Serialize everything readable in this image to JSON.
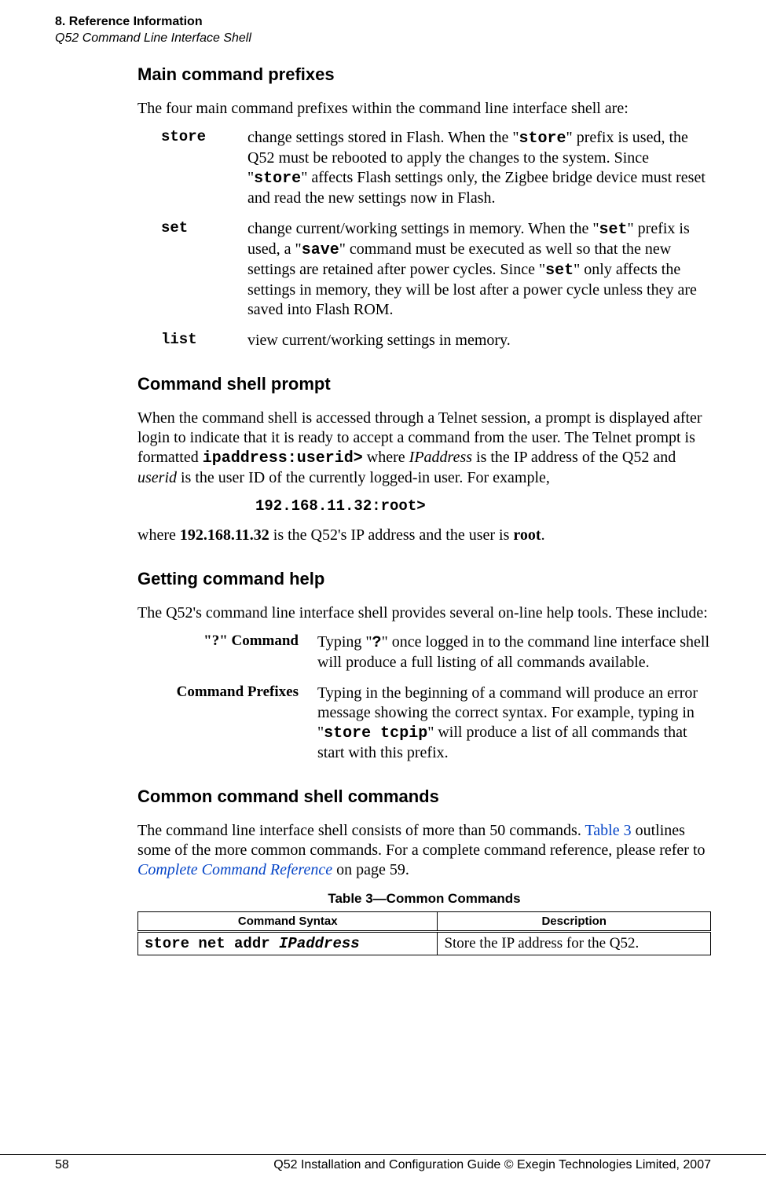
{
  "header": {
    "chapter": "8. Reference Information",
    "subtitle": "Q52 Command Line Interface Shell"
  },
  "sections": {
    "prefixes": {
      "heading": "Main command prefixes",
      "intro": "The four main command prefixes within the command line interface shell are:",
      "items": [
        {
          "term": "store",
          "desc_pre": "change settings stored in Flash. When the \"",
          "kw1": "store",
          "desc_mid": "\" prefix is used, the Q52 must be rebooted to apply the changes to the system. Since \"",
          "kw2": "store",
          "desc_post": "\" affects Flash settings only, the Zigbee bridge device must reset and read the new settings now in Flash."
        },
        {
          "term": "set",
          "desc_pre": "change current/working settings in memory. When the \"",
          "kw1": "set",
          "desc_mid1": "\" prefix is used, a \"",
          "kw2": "save",
          "desc_mid2": "\" command must be executed as well so that the new settings are retained after power cycles. Since \"",
          "kw3": "set",
          "desc_post": "\" only affects the settings in memory, they will be lost after a power cycle unless they are saved into Flash ROM."
        },
        {
          "term": "list",
          "desc": "view current/working settings in memory."
        }
      ]
    },
    "prompt": {
      "heading": "Command shell prompt",
      "p1_pre": "When the command shell is accessed through a Telnet session, a prompt is displayed after login to indicate that it is ready to accept a command from the user. The Telnet prompt is formatted ",
      "p1_code": "ipaddress:userid>",
      "p1_mid": " where ",
      "p1_it1": "IPaddress",
      "p1_mid2": " is the IP address of the Q52 and ",
      "p1_it2": "userid",
      "p1_post": " is the user ID of the currently logged-in user. For example,",
      "example": "192.168.11.32:root>",
      "p2_pre": "where ",
      "p2_b1": "192.168.11.32",
      "p2_mid": " is the Q52's IP address and the user is ",
      "p2_b2": "root",
      "p2_post": "."
    },
    "help": {
      "heading": "Getting command help",
      "intro": "The Q52's command line interface shell provides several on-line help tools. These include:",
      "items": [
        {
          "term": "\"?\" Command",
          "pre": "Typing \"",
          "kw": "?",
          "post": "\" once logged in to the command line interface shell will produce a full listing of all commands available."
        },
        {
          "term": "Command Prefixes",
          "pre": "Typing in the beginning of a command will produce an error message showing the correct syntax. For example, typing in \"",
          "kw": "store tcpip",
          "post": "\" will produce a list of all commands that start with this prefix."
        }
      ]
    },
    "common": {
      "heading": "Common command shell commands",
      "p_pre": "The command line interface shell consists of more than 50 commands. ",
      "p_link1": "Table 3",
      "p_mid": " outlines some of the more common commands. For a complete command reference, please refer to ",
      "p_link2": "Complete Command Reference",
      "p_post": " on page 59.",
      "caption": "Table 3—Common Commands",
      "th1": "Command Syntax",
      "th2": "Description",
      "row1_cmd": "store net addr ",
      "row1_param": "IPaddress",
      "row1_desc": "Store the IP address for the Q52."
    }
  },
  "footer": {
    "page": "58",
    "text": "Q52 Installation and Configuration Guide  © Exegin Technologies Limited, 2007"
  }
}
